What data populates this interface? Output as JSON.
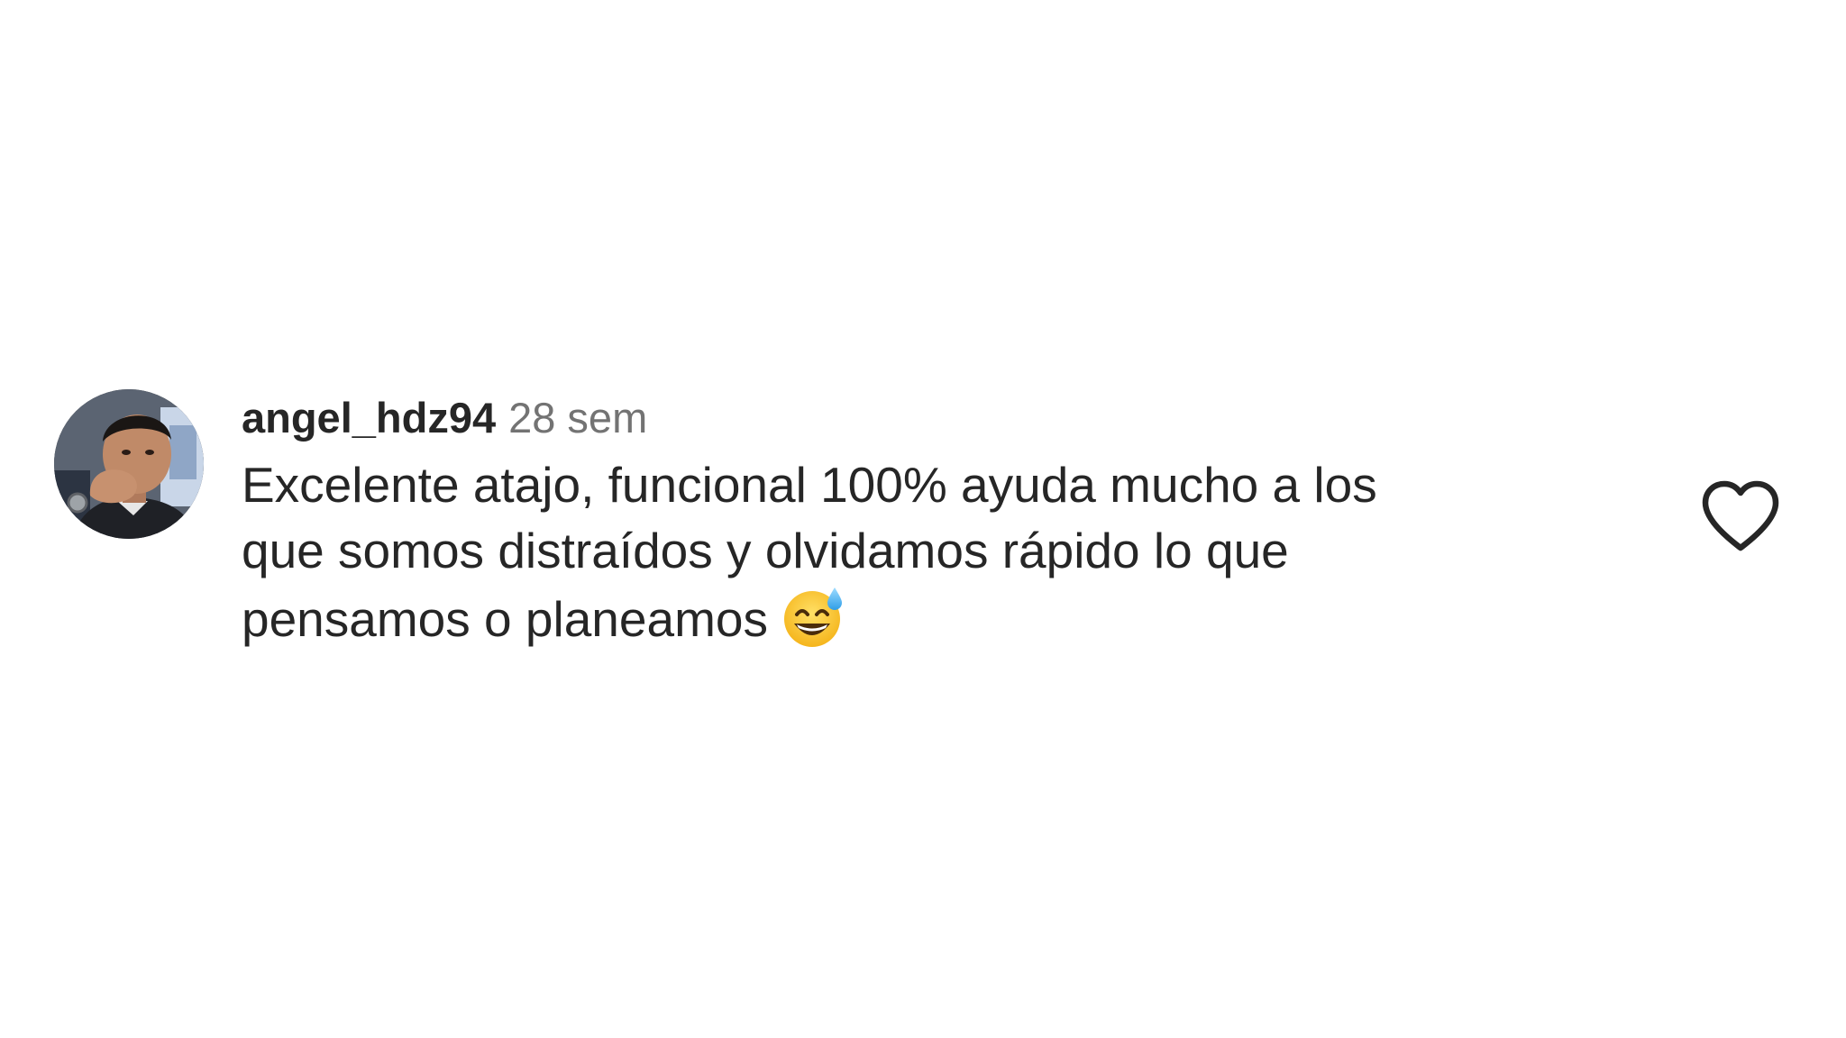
{
  "comment": {
    "username": "angel_hdz94",
    "timestamp": "28 sem",
    "text_lines": [
      "Excelente atajo, funcional 100% ayuda mucho a los",
      "que somos distraídos y olvidamos rápido lo que",
      "pensamos o planeamos"
    ],
    "emoji": "grinning-face-with-sweat",
    "liked": false
  },
  "icons": {
    "like": "heart-outline-icon",
    "avatar": "user-avatar-photo"
  },
  "colors": {
    "text_primary": "#262626",
    "text_secondary": "#737373",
    "background": "#ffffff"
  }
}
